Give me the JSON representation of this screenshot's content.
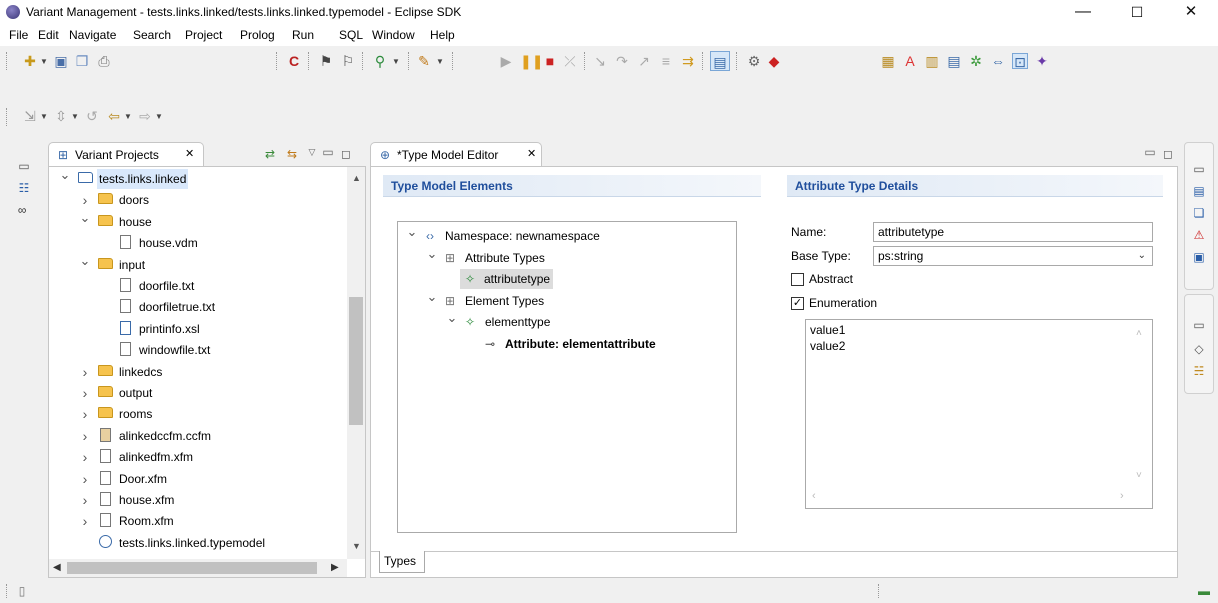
{
  "window": {
    "title": "Variant Management - tests.links.linked/tests.links.linked.typemodel - Eclipse SDK",
    "min": "—",
    "max": "☐",
    "close": "✕"
  },
  "menu": [
    "File",
    "Edit",
    "Navigate",
    "Search",
    "Project",
    "Prolog",
    "Run",
    "SQL",
    "Window",
    "Help"
  ],
  "left_panel": {
    "tab_label": "Variant Projects",
    "tab_close": "✕",
    "tree": [
      {
        "label": "tests.links.linked",
        "level": 0,
        "icon": "project-folder-icon",
        "expanded": true,
        "selected": true
      },
      {
        "label": "doors",
        "level": 1,
        "icon": "folder-icon",
        "expanded": false
      },
      {
        "label": "house",
        "level": 1,
        "icon": "folder-icon",
        "expanded": true
      },
      {
        "label": "house.vdm",
        "level": 2,
        "icon": "vdm-file-icon"
      },
      {
        "label": "input",
        "level": 1,
        "icon": "folder-open-icon",
        "expanded": true
      },
      {
        "label": "doorfile.txt",
        "level": 2,
        "icon": "text-file-icon"
      },
      {
        "label": "doorfiletrue.txt",
        "level": 2,
        "icon": "text-file-icon"
      },
      {
        "label": "printinfo.xsl",
        "level": 2,
        "icon": "xsl-file-icon"
      },
      {
        "label": "windowfile.txt",
        "level": 2,
        "icon": "text-file-icon"
      },
      {
        "label": "linkedcs",
        "level": 1,
        "icon": "folder-icon",
        "expanded": false
      },
      {
        "label": "output",
        "level": 1,
        "icon": "folder-icon",
        "expanded": false
      },
      {
        "label": "rooms",
        "level": 1,
        "icon": "folder-icon",
        "expanded": false
      },
      {
        "label": "alinkedccfm.ccfm",
        "level": 1,
        "icon": "ccfm-file-icon",
        "expanded": false
      },
      {
        "label": "alinkedfm.xfm",
        "level": 1,
        "icon": "xfm-file-icon",
        "expanded": false
      },
      {
        "label": "Door.xfm",
        "level": 1,
        "icon": "xfm-file-icon",
        "expanded": false
      },
      {
        "label": "house.xfm",
        "level": 1,
        "icon": "xfm-file-icon",
        "expanded": false
      },
      {
        "label": "Room.xfm",
        "level": 1,
        "icon": "xfm-file-icon",
        "expanded": false
      },
      {
        "label": "tests.links.linked.typemodel",
        "level": 1,
        "icon": "typemodel-file-icon"
      }
    ]
  },
  "editor": {
    "tab_label": "*Type Model Editor",
    "tab_close": "✕",
    "left_section_title": "Type Model Elements",
    "right_section_title": "Attribute Type Details",
    "tree": [
      {
        "label": "Namespace: newnamespace",
        "level": 0,
        "icon": "namespace-icon",
        "expanded": true
      },
      {
        "label": "Attribute Types",
        "level": 1,
        "icon": "table-icon",
        "expanded": true
      },
      {
        "label": "attributetype",
        "level": 2,
        "icon": "attribute-type-icon",
        "selected": true
      },
      {
        "label": "Element Types",
        "level": 1,
        "icon": "table-icon",
        "expanded": true
      },
      {
        "label": "elementtype",
        "level": 2,
        "icon": "element-type-icon",
        "expanded": true
      },
      {
        "label": "Attribute: elementattribute",
        "level": 3,
        "icon": "attribute-link-icon",
        "bold": true
      }
    ],
    "details": {
      "name_label": "Name:",
      "name_value": "attributetype",
      "base_type_label": "Base Type:",
      "base_type_value": "ps:string",
      "abstract_label": "Abstract",
      "abstract_checked": false,
      "enumeration_label": "Enumeration",
      "enumeration_checked": true,
      "enum_values": [
        "value1",
        "value2"
      ]
    },
    "bottom_tab": "Types"
  },
  "colors": {
    "section_title": "#1f4e9c",
    "selection": "#dcdcdc",
    "window_bg": "#f0f0f0"
  }
}
